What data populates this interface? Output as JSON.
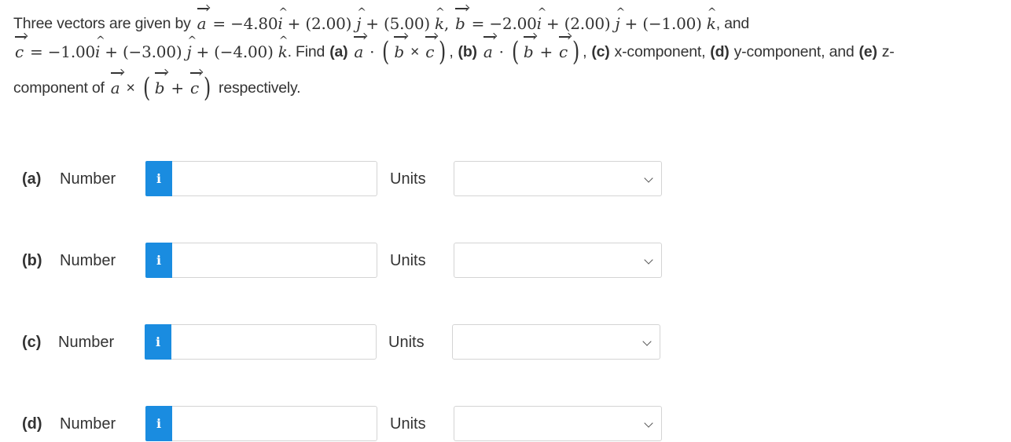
{
  "question": {
    "intro": "Three vectors are given by",
    "a_label": "a",
    "a_eq": "= −4.80",
    "a_j": "+ (2.00)",
    "a_k": "+ (5.00)",
    "b_label": "b",
    "b_eq": "= −2.00",
    "b_j": "+ (2.00)",
    "b_k": "+ (−1.00)",
    "and": ", and",
    "c_label": "c",
    "c_eq": "= −1.00",
    "c_j": "+ (−3.00)",
    "c_k": "+ (−4.00)",
    "find": ". Find",
    "part_a": "(a)",
    "part_b": "(b)",
    "part_c": "(c)",
    "part_d": "(d)",
    "part_e": "(e)",
    "x_comp": "x-component,",
    "y_comp": "y-component, and",
    "z_comp": "z-",
    "component_of": "component of",
    "respectively": "respectively.",
    "i_hat": "i",
    "j_hat": "j",
    "k_hat": "k",
    "dot": "·",
    "cross": "×",
    "plus": "+",
    "comma": ","
  },
  "rows": [
    {
      "part": "(a)",
      "number_label": "Number",
      "value": "",
      "units_label": "Units",
      "units_value": ""
    },
    {
      "part": "(b)",
      "number_label": "Number",
      "value": "",
      "units_label": "Units",
      "units_value": ""
    },
    {
      "part": "(c)",
      "number_label": "Number",
      "value": "",
      "units_label": "Units",
      "units_value": ""
    },
    {
      "part": "(d)",
      "number_label": "Number",
      "value": "",
      "units_label": "Units",
      "units_value": ""
    }
  ],
  "info_icon_glyph": "i",
  "colors": {
    "info_button": "#1a8ce0",
    "text": "#333333",
    "border": "#d4d4d4"
  }
}
